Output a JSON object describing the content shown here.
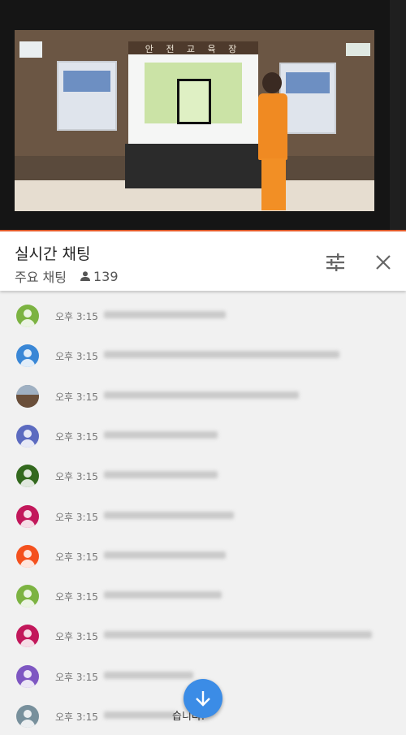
{
  "video": {
    "banner_text": "안 전 교 육 장"
  },
  "chat_header": {
    "title": "실시간 채팅",
    "mode_label": "주요 채팅",
    "viewer_count": "139",
    "icons": {
      "viewers": "person-icon",
      "filter": "tune-icon",
      "close": "close-icon"
    }
  },
  "messages": [
    {
      "time": "오후 3:15",
      "avatar_color": "#7cb342",
      "avatar_type": "default"
    },
    {
      "time": "오후 3:15",
      "avatar_color": "#3a87d6",
      "avatar_type": "default"
    },
    {
      "time": "오후 3:15",
      "avatar_color": "#6f7f8f",
      "avatar_type": "photo"
    },
    {
      "time": "오후 3:15",
      "avatar_color": "#5c6bc0",
      "avatar_type": "default"
    },
    {
      "time": "오후 3:15",
      "avatar_color": "#33691e",
      "avatar_type": "default"
    },
    {
      "time": "오후 3:15",
      "avatar_color": "#c2185b",
      "avatar_type": "default"
    },
    {
      "time": "오후 3:15",
      "avatar_color": "#f4511e",
      "avatar_type": "default"
    },
    {
      "time": "오후 3:15",
      "avatar_color": "#7cb342",
      "avatar_type": "default"
    },
    {
      "time": "오후 3:15",
      "avatar_color": "#c2185b",
      "avatar_type": "default"
    },
    {
      "time": "오후 3:15",
      "avatar_color": "#7e57c2",
      "avatar_type": "default"
    },
    {
      "time": "오후 3:15",
      "avatar_color": "#78909c",
      "avatar_type": "default",
      "visible_tail": "습니다."
    }
  ],
  "scroll_button": {
    "icon": "arrow-down-icon",
    "color": "#3b8ce6"
  }
}
